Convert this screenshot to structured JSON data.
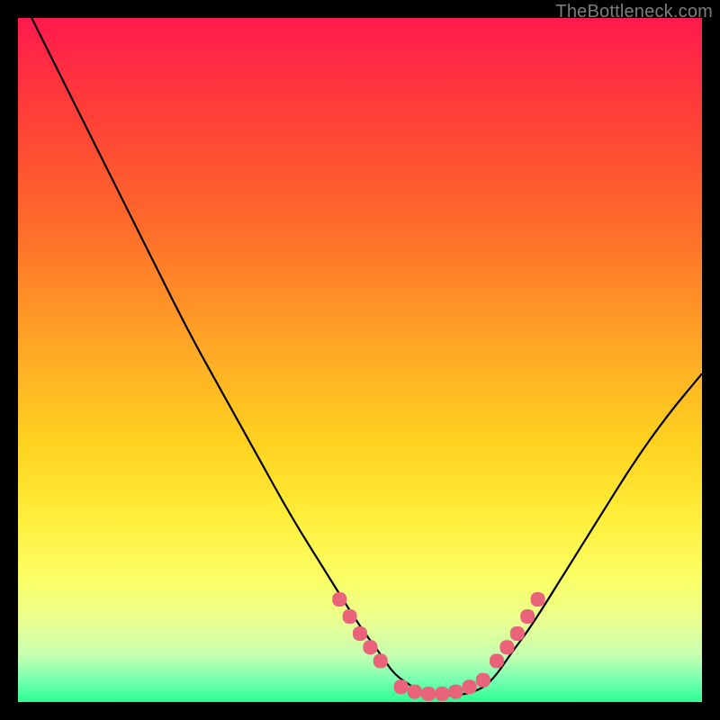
{
  "watermark": "TheBottleneck.com",
  "colors": {
    "background": "#000000",
    "curve": "#000000",
    "marker": "#e9637a",
    "gradient_top": "#ff1a4d",
    "gradient_bottom": "#2bff8f"
  },
  "chart_data": {
    "type": "line",
    "title": "",
    "xlabel": "",
    "ylabel": "",
    "xlim": [
      0,
      100
    ],
    "ylim": [
      0,
      100
    ],
    "x": [
      2,
      5,
      10,
      15,
      20,
      25,
      30,
      35,
      40,
      45,
      50,
      53,
      55,
      58,
      60,
      62,
      65,
      68,
      70,
      72,
      75,
      80,
      85,
      90,
      95,
      100
    ],
    "values": [
      100,
      94,
      84,
      74,
      64,
      54,
      45,
      36,
      27,
      19,
      11,
      7,
      4,
      2,
      1,
      1,
      1,
      2,
      4,
      7,
      11,
      19,
      27,
      35,
      42,
      48
    ],
    "markers": {
      "left_slope": {
        "x": [
          47,
          48.5,
          50,
          51.5,
          53
        ],
        "y": [
          15,
          12.5,
          10,
          8,
          6
        ]
      },
      "valley": {
        "x": [
          56,
          58,
          60,
          62,
          64,
          66,
          68
        ],
        "y": [
          2.2,
          1.5,
          1.2,
          1.2,
          1.5,
          2.2,
          3.2
        ]
      },
      "right_slope": {
        "x": [
          70,
          71.5,
          73,
          74.5,
          76
        ],
        "y": [
          6,
          8,
          10,
          12.5,
          15
        ]
      }
    }
  }
}
